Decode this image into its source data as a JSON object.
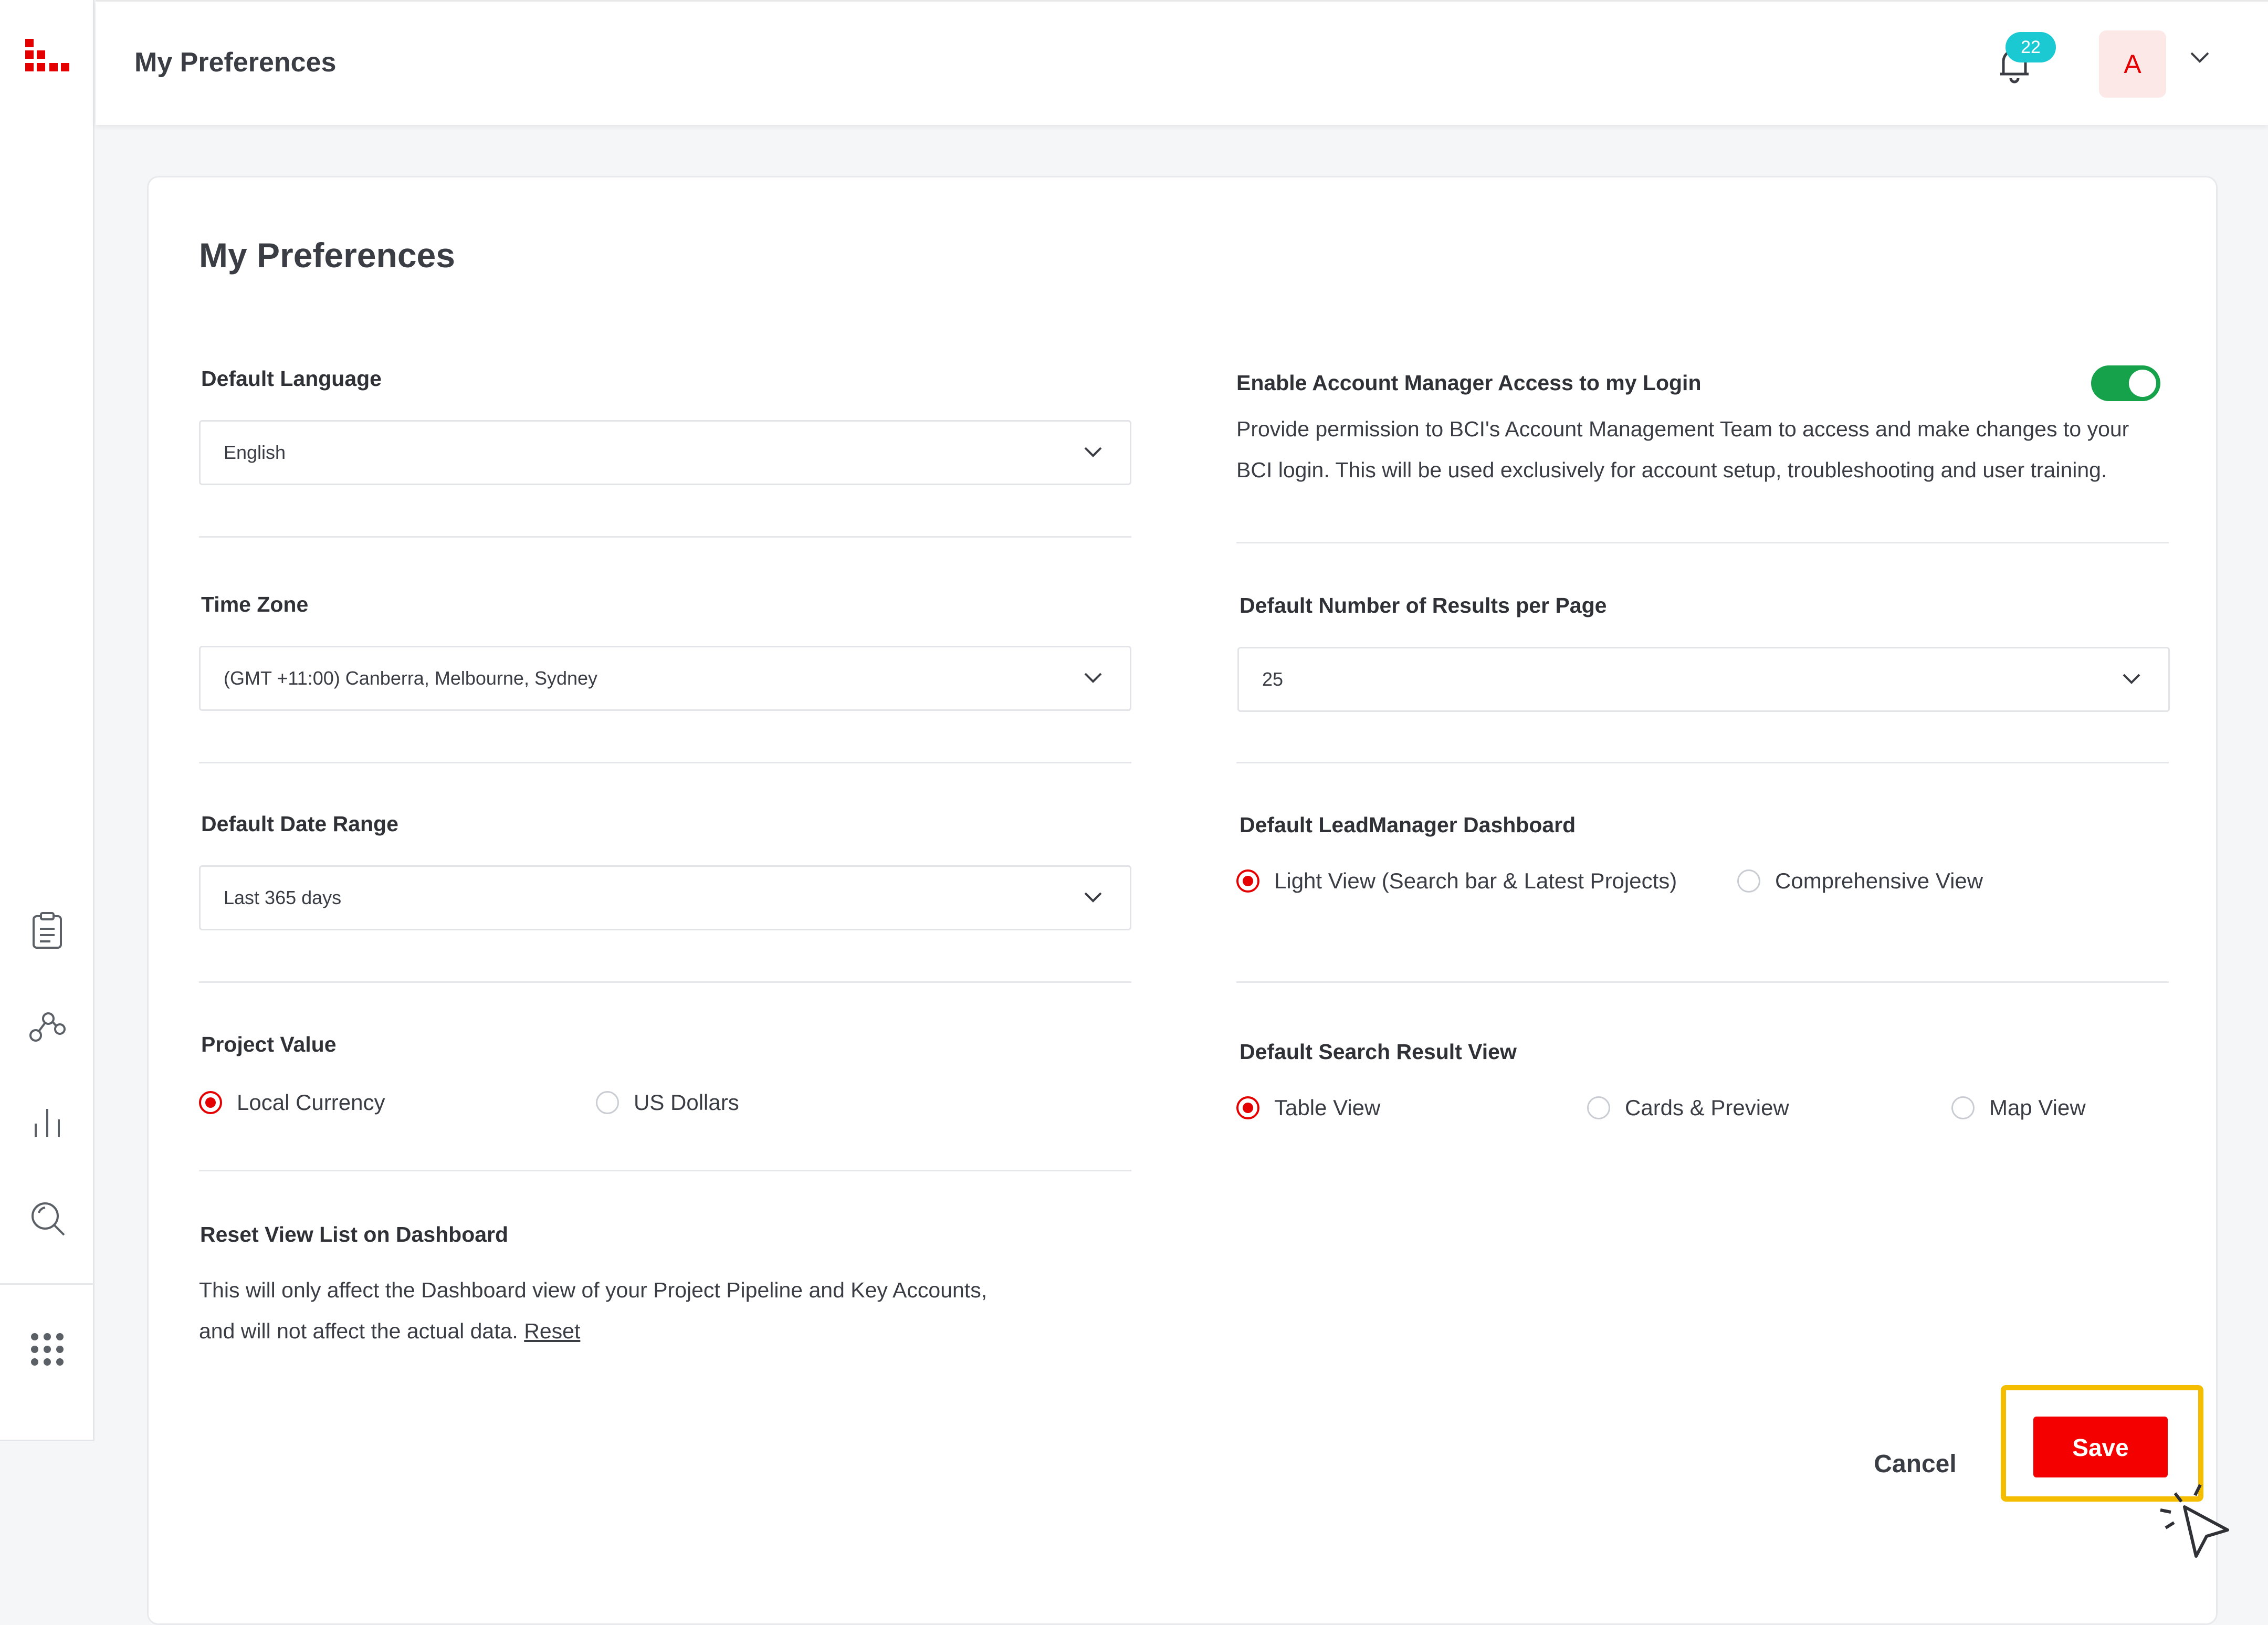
{
  "colors": {
    "accent": "#f40000",
    "toggle_on": "#16a24a",
    "badge": "#1bc9d3",
    "highlight": "#f5bd00"
  },
  "header": {
    "title": "My Preferences",
    "notification_count": "22",
    "avatar_initial": "A"
  },
  "sidebar": {
    "icons": [
      "logo-icon",
      "clipboard-icon",
      "network-icon",
      "bar-chart-icon",
      "search-icon",
      "apps-grid-icon"
    ]
  },
  "page": {
    "title": "My Preferences",
    "default_language": {
      "label": "Default Language",
      "value": "English"
    },
    "time_zone": {
      "label": "Time Zone",
      "value": "(GMT +11:00) Canberra, Melbourne, Sydney"
    },
    "default_date_range": {
      "label": "Default Date Range",
      "value": "Last 365 days"
    },
    "project_value": {
      "label": "Project Value",
      "options": [
        "Local Currency",
        "US Dollars"
      ],
      "selected": "Local Currency"
    },
    "reset_view": {
      "label": "Reset View List on Dashboard",
      "line1": "This will only affect the Dashboard view of your Project Pipeline and Key Accounts,",
      "line2": "and will not affect the actual data.",
      "link": "Reset"
    },
    "account_manager_access": {
      "label": "Enable Account Manager Access to my Login",
      "enabled": true,
      "line1": "Provide permission to BCI's Account Management Team to access and make changes to your",
      "line2": "BCI login. This will be used exclusively for account setup, troubleshooting and user training."
    },
    "results_per_page": {
      "label": "Default Number of Results per Page",
      "value": "25"
    },
    "leadmanager_dashboard": {
      "label": "Default LeadManager Dashboard",
      "options": [
        "Light View (Search bar & Latest Projects)",
        "Comprehensive View"
      ],
      "selected": "Light View (Search bar & Latest Projects)"
    },
    "search_result_view": {
      "label": "Default Search Result View",
      "options": [
        "Table View",
        "Cards & Preview",
        "Map View"
      ],
      "selected": "Table View"
    },
    "buttons": {
      "cancel": "Cancel",
      "save": "Save"
    }
  }
}
